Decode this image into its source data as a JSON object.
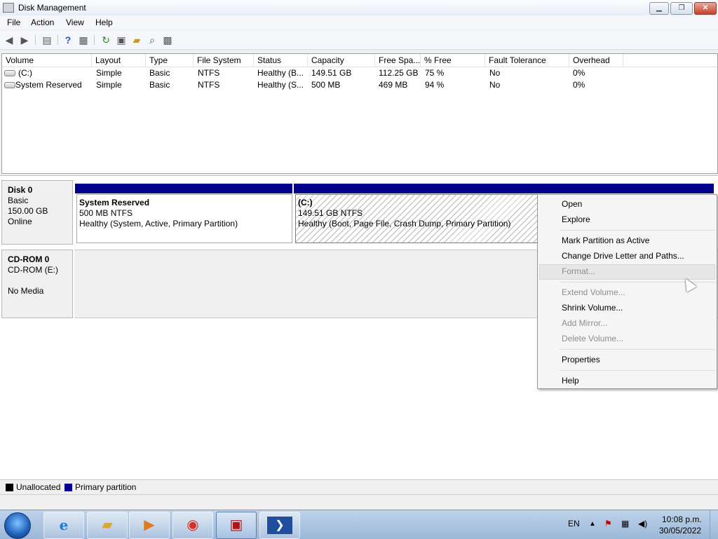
{
  "window": {
    "title": "Disk Management"
  },
  "menubar": {
    "items": [
      "File",
      "Action",
      "View",
      "Help"
    ]
  },
  "toolbar": {
    "icons": [
      "back-icon",
      "forward-icon",
      "console-tree-icon",
      "help-icon",
      "show-hide-icon",
      "refresh-icon",
      "properties-icon",
      "open-folder-icon",
      "explore-icon",
      "rescan-icon"
    ]
  },
  "volumes": {
    "columns": [
      "Volume",
      "Layout",
      "Type",
      "File System",
      "Status",
      "Capacity",
      "Free Spa...",
      "% Free",
      "Fault Tolerance",
      "Overhead"
    ],
    "rows": [
      [
        "(C:)",
        "Simple",
        "Basic",
        "NTFS",
        "Healthy (B...",
        "149.51 GB",
        "112.25 GB",
        "75 %",
        "No",
        "0%"
      ],
      [
        "System Reserved",
        "Simple",
        "Basic",
        "NTFS",
        "Healthy (S...",
        "500 MB",
        "469 MB",
        "94 %",
        "No",
        "0%"
      ]
    ]
  },
  "disks": [
    {
      "name": "Disk 0",
      "type": "Basic",
      "size": "150.00 GB",
      "status": "Online"
    },
    {
      "name": "CD-ROM 0",
      "type": "CD-ROM (E:)",
      "size": "",
      "status": "No Media"
    }
  ],
  "partitions": [
    {
      "name": "System Reserved",
      "size": "500 MB NTFS",
      "status": "Healthy (System, Active, Primary Partition)"
    },
    {
      "name": "(C:)",
      "size": "149.51 GB NTFS",
      "status": "Healthy (Boot, Page File, Crash Dump, Primary Partition)"
    }
  ],
  "legend": {
    "unallocated": "Unallocated",
    "primary": "Primary partition",
    "unallocated_color": "#000000",
    "primary_color": "#00008b"
  },
  "context_menu": {
    "open": "Open",
    "explore": "Explore",
    "mark_active": "Mark Partition as Active",
    "change_letter": "Change Drive Letter and Paths...",
    "format": "Format...",
    "extend": "Extend Volume...",
    "shrink": "Shrink Volume...",
    "add_mirror": "Add Mirror...",
    "delete": "Delete Volume...",
    "properties": "Properties",
    "help": "Help"
  },
  "taskbar": {
    "apps": [
      "internet-explorer-icon",
      "file-explorer-icon",
      "media-player-icon",
      "chrome-icon",
      "toolbox-icon",
      "powershell-icon"
    ],
    "lang": "EN",
    "time": "10:08 p.m.",
    "date": "30/05/2022"
  }
}
